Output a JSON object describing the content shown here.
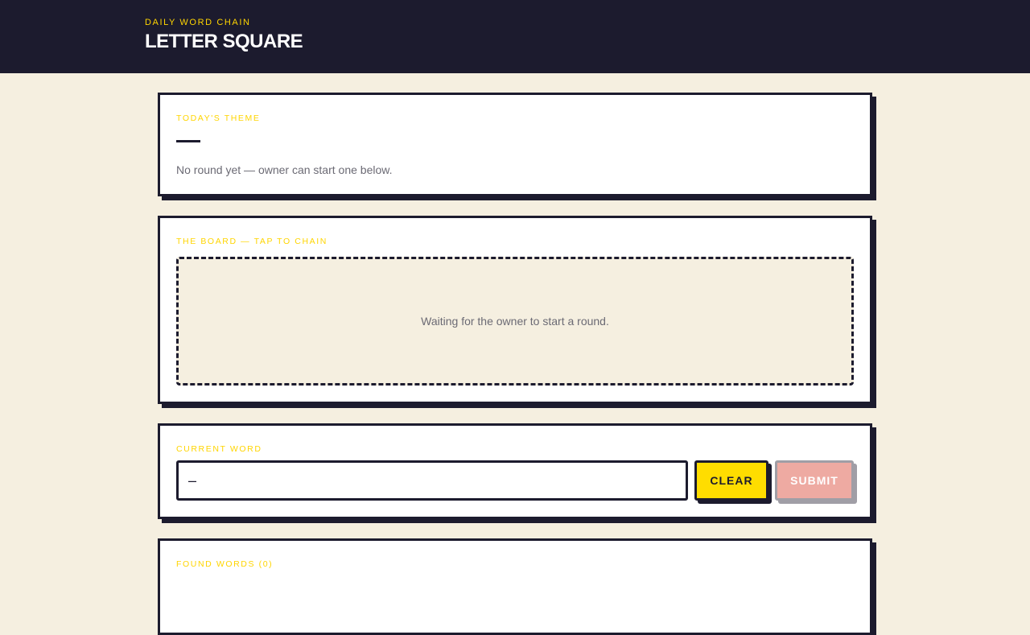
{
  "header": {
    "eyebrow": "DAILY WORD CHAIN",
    "title": "LETTER SQUARE"
  },
  "theme": {
    "label": "TODAY'S THEME",
    "message": "No round yet — owner can start one below."
  },
  "board": {
    "label": "THE BOARD — TAP TO CHAIN",
    "message": "Waiting for the owner to start a round."
  },
  "current_word": {
    "label": "CURRENT WORD",
    "value": "–",
    "clear_label": "CLEAR",
    "submit_label": "SUBMIT"
  },
  "found_words": {
    "label": "FOUND WORDS (0)"
  },
  "colors": {
    "accent": "#ffd500",
    "dark": "#1c1b2e",
    "background": "#f5efe0",
    "submit_disabled": "#eeaaa2"
  }
}
